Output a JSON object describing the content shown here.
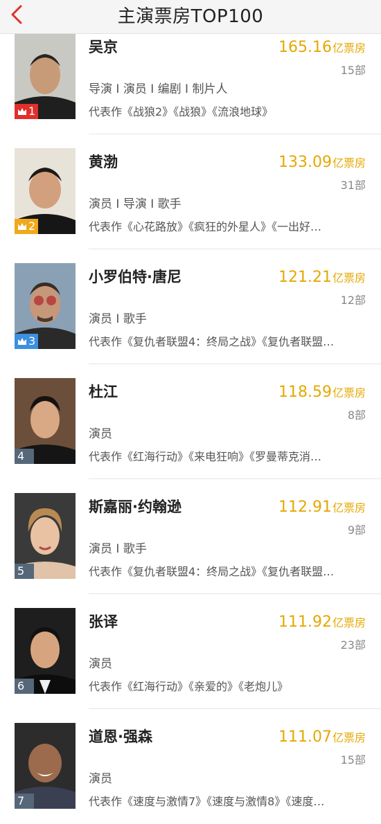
{
  "header": {
    "title": "主演票房TOP100"
  },
  "unit": "亿票房",
  "colors": {
    "gold": "#e5a800",
    "rank1": "#e0302b",
    "rank2": "#f0a91c",
    "rank3": "#3d8fe0",
    "rankOther": "#56677a"
  },
  "stars": [
    {
      "rank": "1",
      "name": "吴京",
      "gross": "165.16",
      "count": "15部",
      "roles": "导演 I 演员 I 编剧 I 制片人",
      "works": "代表作《战狼2》《战狼》《流浪地球》"
    },
    {
      "rank": "2",
      "name": "黄渤",
      "gross": "133.09",
      "count": "31部",
      "roles": "演员 I 导演 I 歌手",
      "works": "代表作《心花路放》《疯狂的外星人》《一出好…"
    },
    {
      "rank": "3",
      "name": "小罗伯特·唐尼",
      "gross": "121.21",
      "count": "12部",
      "roles": "演员 I 歌手",
      "works": "代表作《复仇者联盟4：终局之战》《复仇者联盟…"
    },
    {
      "rank": "4",
      "name": "杜江",
      "gross": "118.59",
      "count": "8部",
      "roles": "演员",
      "works": "代表作《红海行动》《来电狂响》《罗曼蒂克消…"
    },
    {
      "rank": "5",
      "name": "斯嘉丽·约翰逊",
      "gross": "112.91",
      "count": "9部",
      "roles": "演员 I 歌手",
      "works": "代表作《复仇者联盟4：终局之战》《复仇者联盟…"
    },
    {
      "rank": "6",
      "name": "张译",
      "gross": "111.92",
      "count": "23部",
      "roles": "演员",
      "works": "代表作《红海行动》《亲爱的》《老炮儿》"
    },
    {
      "rank": "7",
      "name": "道恩·强森",
      "gross": "111.07",
      "count": "15部",
      "roles": "演员",
      "works": "代表作《速度与激情7》《速度与激情8》《速度…"
    }
  ]
}
